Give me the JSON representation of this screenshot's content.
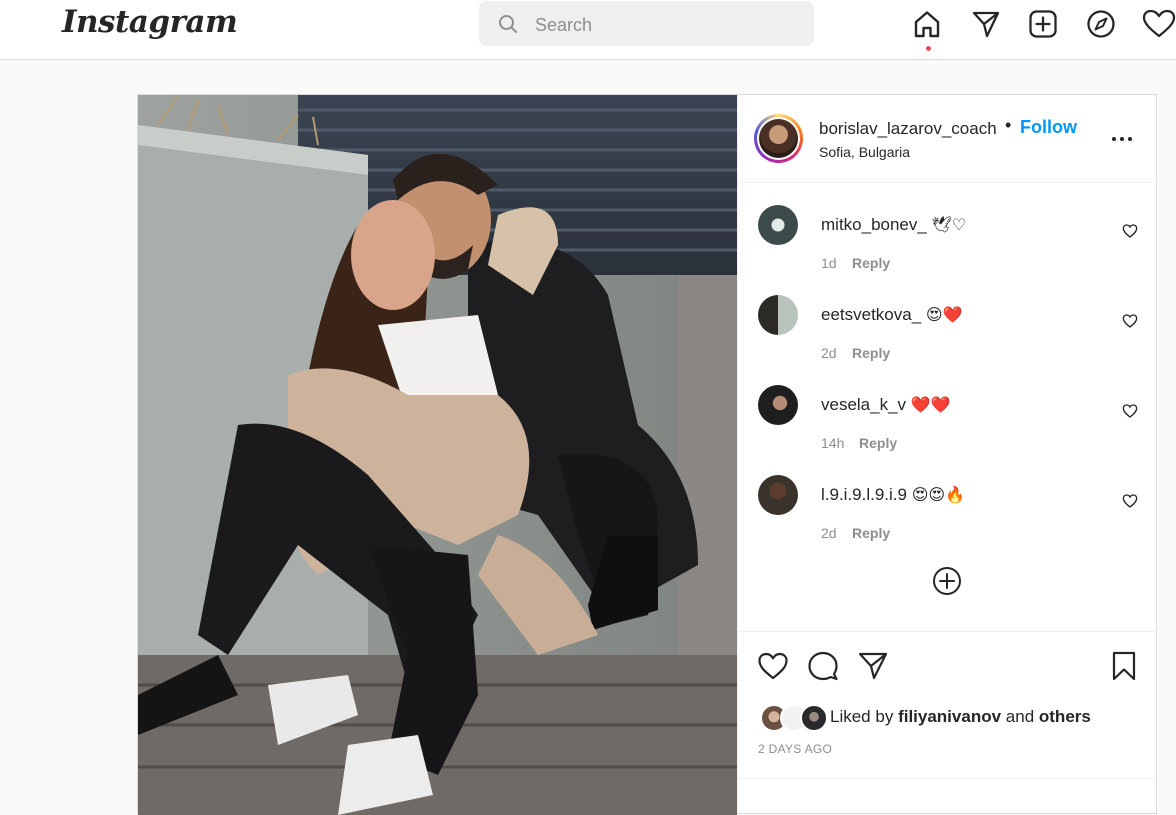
{
  "nav": {
    "logo": "Instagram",
    "search_placeholder": "Search",
    "icons": [
      "home-icon",
      "direct-icon",
      "new-post-icon",
      "explore-icon",
      "activity-icon"
    ]
  },
  "post": {
    "owner": "borislav_lazarov_coach",
    "separator": "•",
    "follow_label": "Follow",
    "location": "Sofia, Bulgaria",
    "comments": [
      {
        "user": "mitko_bonev_",
        "emoji": "🕊♡",
        "time": "1d",
        "reply": "Reply",
        "avatar_color": "#3d4a4a"
      },
      {
        "user": "eetsvetkova_",
        "emoji": "😍❤️",
        "time": "2d",
        "reply": "Reply",
        "avatar_color": "#a5b4a0"
      },
      {
        "user": "vesela_k_v",
        "emoji": "❤️❤️",
        "time": "14h",
        "reply": "Reply",
        "avatar_color": "#2b2b2b"
      },
      {
        "user": "l.9.i.9.l.9.i.9",
        "emoji": "😍😍🔥",
        "time": "2d",
        "reply": "Reply",
        "avatar_color": "#3a332c"
      }
    ],
    "liked_prefix": "Liked by",
    "liked_user": "filiyanivanov",
    "liked_and": "and",
    "liked_others": "others",
    "time_ago": "2 DAYS AGO"
  },
  "colors": {
    "accent": "#0095f6",
    "text": "#262626",
    "muted": "#8e8e8e",
    "notification": "#ed4956"
  }
}
